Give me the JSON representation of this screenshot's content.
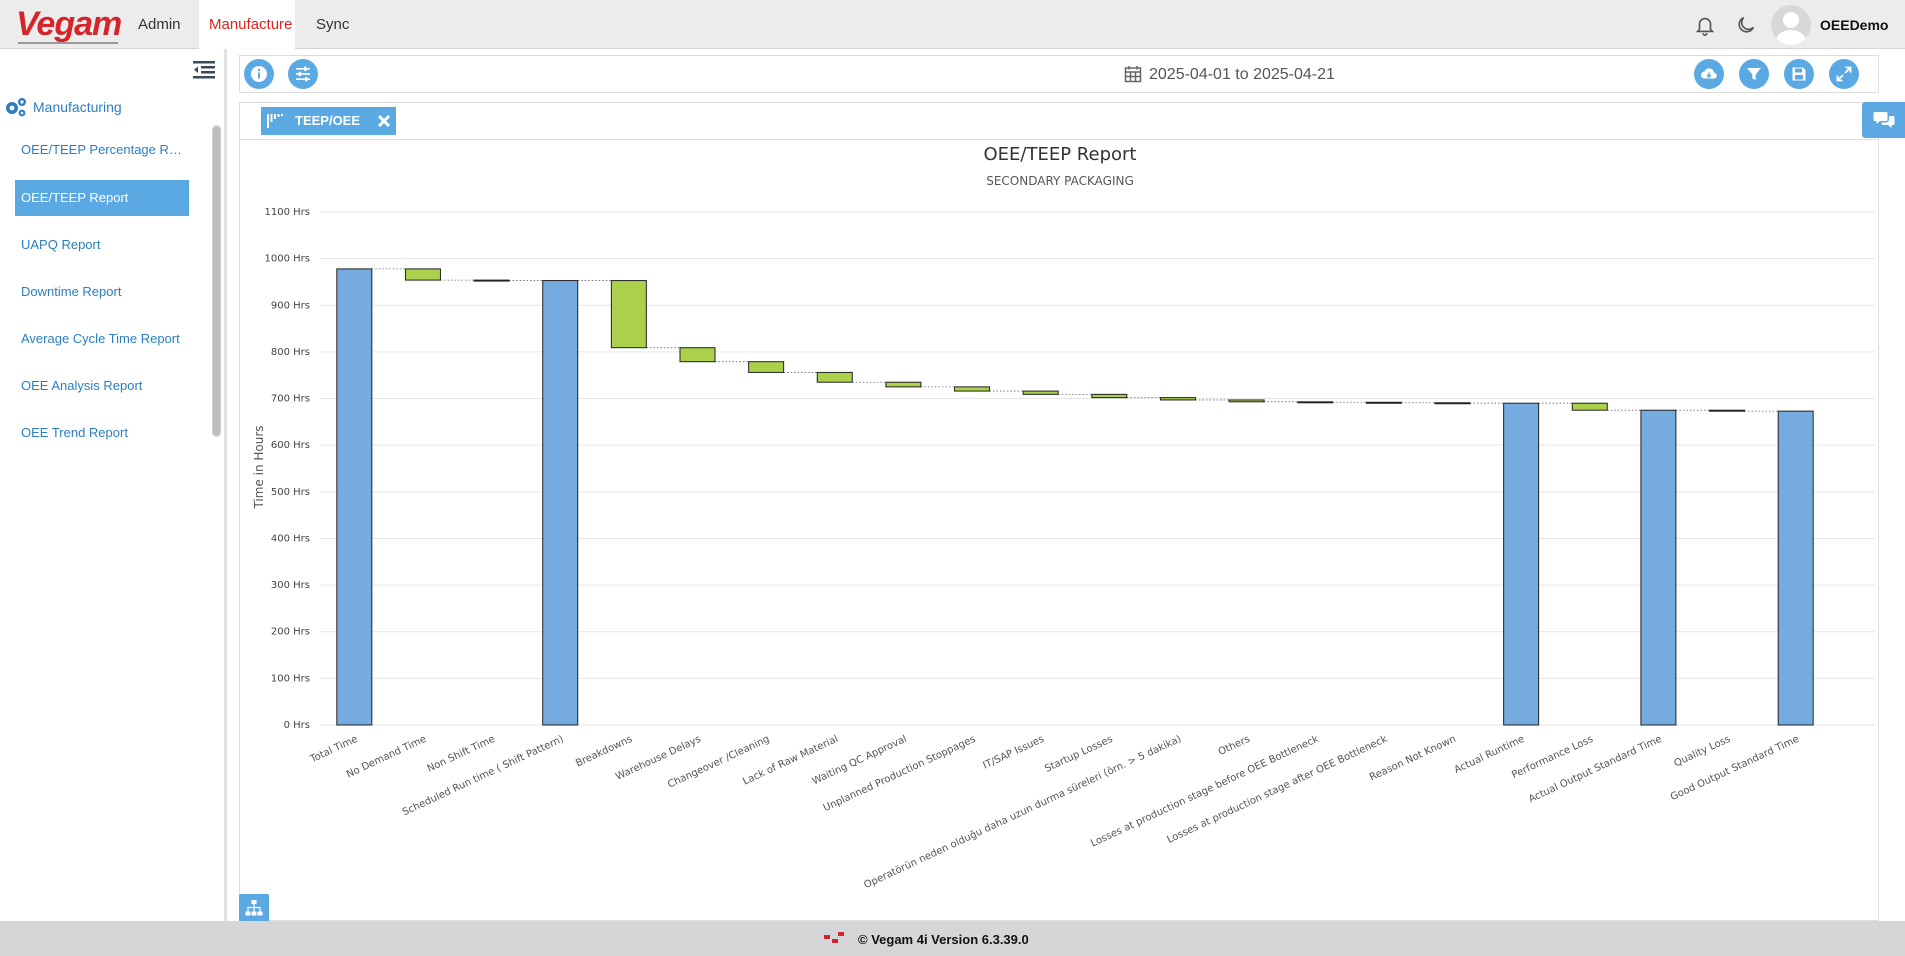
{
  "app": {
    "logo_text": "Vegam",
    "nav": [
      {
        "label": "Admin",
        "active": false
      },
      {
        "label": "Manufacture",
        "active": true
      },
      {
        "label": "Sync",
        "active": false
      }
    ],
    "username": "OEEDemo",
    "icons": [
      "bell-icon",
      "moon-icon",
      "avatar"
    ]
  },
  "sidebar": {
    "heading": "Manufacturing",
    "items": [
      {
        "label": "OEE/TEEP Percentage Report",
        "active": false
      },
      {
        "label": "OEE/TEEP Report",
        "active": true
      },
      {
        "label": "UAPQ Report",
        "active": false
      },
      {
        "label": "Downtime Report",
        "active": false
      },
      {
        "label": "Average Cycle Time Report",
        "active": false
      },
      {
        "label": "OEE Analysis Report",
        "active": false
      },
      {
        "label": "OEE Trend Report",
        "active": false
      }
    ]
  },
  "toolbar": {
    "date_from": "2025-04-01",
    "date_to": "2025-04-21",
    "date_range_label": "2025-04-01 to 2025-04-21",
    "left_icons": [
      "info-icon",
      "sliders-icon"
    ],
    "right_icons": [
      "cloud-download-icon",
      "filter-icon",
      "save-icon",
      "expand-icon"
    ]
  },
  "tabs": [
    {
      "label": "TEEP/OEE",
      "closable": true
    }
  ],
  "chart_data": {
    "type": "bar",
    "subtype": "waterfall",
    "title": "OEE/TEEP Report",
    "subtitle": "SECONDARY PACKAGING",
    "xlabel": "",
    "ylabel": "Time in Hours",
    "ylim": [
      0,
      1100
    ],
    "yticks": [
      0,
      100,
      200,
      300,
      400,
      500,
      600,
      700,
      800,
      900,
      1000,
      1100
    ],
    "ytick_suffix": " Hrs",
    "grid": true,
    "legend": "none",
    "colors": {
      "total": "#76abe0",
      "loss": "#aad04c",
      "stroke": "#222222"
    },
    "categories": [
      "Total Time",
      "No Demand Time",
      "Non Shift Time",
      "Scheduled Run time ( Shift Pattern)",
      "Breakdowns",
      "Warehouse Delays",
      "Changeover /Cleaning",
      "Lack of Raw Material",
      "Waiting QC Approval",
      "Unplanned Production Stoppages",
      "IT/SAP Issues",
      "Startup Losses",
      "Operatörün neden olduğu daha uzun durma süreleri (örn. > 5 dakika)",
      "Others",
      "Losses at production stage before OEE Bottleneck",
      "Losses at production stage after OEE Bottleneck",
      "Reason Not Known",
      "Actual Runtime",
      "Performance Loss",
      "Actual Output Standard Time",
      "Quality Loss",
      "Good Output Standard Time"
    ],
    "bars": [
      {
        "kind": "total",
        "start": 0,
        "end": 978
      },
      {
        "kind": "loss",
        "start": 978,
        "end": 954
      },
      {
        "kind": "loss",
        "start": 954,
        "end": 953
      },
      {
        "kind": "total",
        "start": 0,
        "end": 953
      },
      {
        "kind": "loss",
        "start": 953,
        "end": 809
      },
      {
        "kind": "loss",
        "start": 809,
        "end": 779
      },
      {
        "kind": "loss",
        "start": 779,
        "end": 756
      },
      {
        "kind": "loss",
        "start": 756,
        "end": 735
      },
      {
        "kind": "loss",
        "start": 735,
        "end": 725
      },
      {
        "kind": "loss",
        "start": 725,
        "end": 716
      },
      {
        "kind": "loss",
        "start": 716,
        "end": 709
      },
      {
        "kind": "loss",
        "start": 709,
        "end": 702
      },
      {
        "kind": "loss",
        "start": 702,
        "end": 697
      },
      {
        "kind": "loss",
        "start": 697,
        "end": 693
      },
      {
        "kind": "loss",
        "start": 693,
        "end": 692
      },
      {
        "kind": "loss",
        "start": 692,
        "end": 691
      },
      {
        "kind": "loss",
        "start": 691,
        "end": 690
      },
      {
        "kind": "total",
        "start": 0,
        "end": 690
      },
      {
        "kind": "loss",
        "start": 690,
        "end": 675
      },
      {
        "kind": "total",
        "start": 0,
        "end": 675
      },
      {
        "kind": "loss",
        "start": 675,
        "end": 673
      },
      {
        "kind": "total",
        "start": 0,
        "end": 673
      }
    ]
  },
  "footer": {
    "text": "© Vegam 4i Version 6.3.39.0"
  }
}
